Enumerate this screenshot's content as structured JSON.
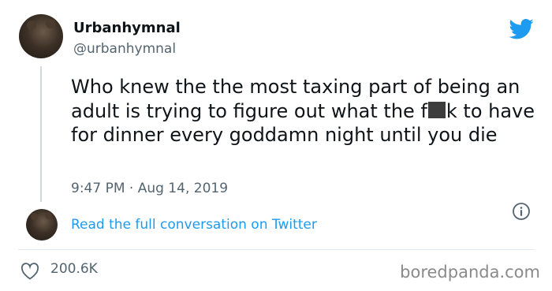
{
  "tweet": {
    "author_name": "Urbanhymnal",
    "handle": "@urbanhymnal",
    "text_before_censor": "Who knew the the most taxing part of being an adult is trying to figure out what the f",
    "text_after_censor": "k to have for dinner every goddamn night until you die",
    "timestamp": "9:47 PM · Aug 14, 2019",
    "read_more_label": "Read the full conversation on Twitter",
    "like_count": "200.6K"
  },
  "icons": {
    "brand": "twitter-bird-icon",
    "info": "info-icon",
    "like": "heart-icon"
  },
  "watermark": "boredpanda.com",
  "colors": {
    "link": "#1d9bf0",
    "brand": "#1d9bf0",
    "text": "#0f1419",
    "secondary": "#536471"
  }
}
